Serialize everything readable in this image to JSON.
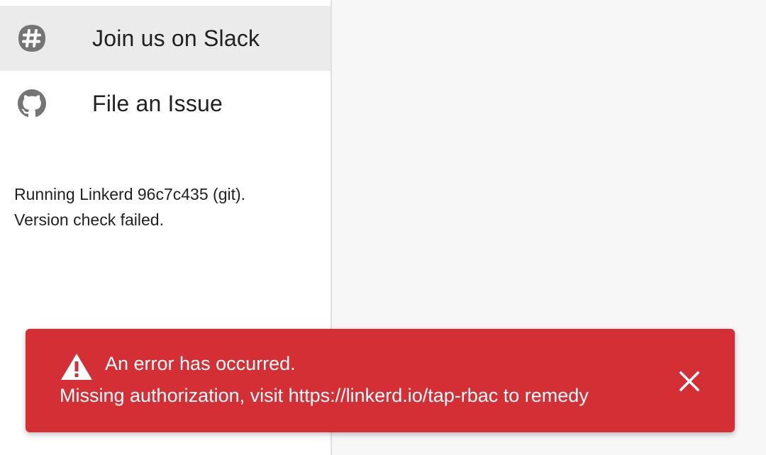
{
  "sidebar": {
    "items": [
      {
        "label": "Join us on Slack",
        "icon": "slack-icon"
      },
      {
        "label": "File an Issue",
        "icon": "github-icon"
      }
    ],
    "version": {
      "line1": "Running Linkerd 96c7c435 (git).",
      "line2": "Version check failed."
    }
  },
  "snackbar": {
    "title": "An error has occurred.",
    "message": "Missing authorization, visit https://linkerd.io/tap-rbac to remedy",
    "icon": "warning-icon",
    "close_icon": "close-icon",
    "color": "#d32f35"
  }
}
